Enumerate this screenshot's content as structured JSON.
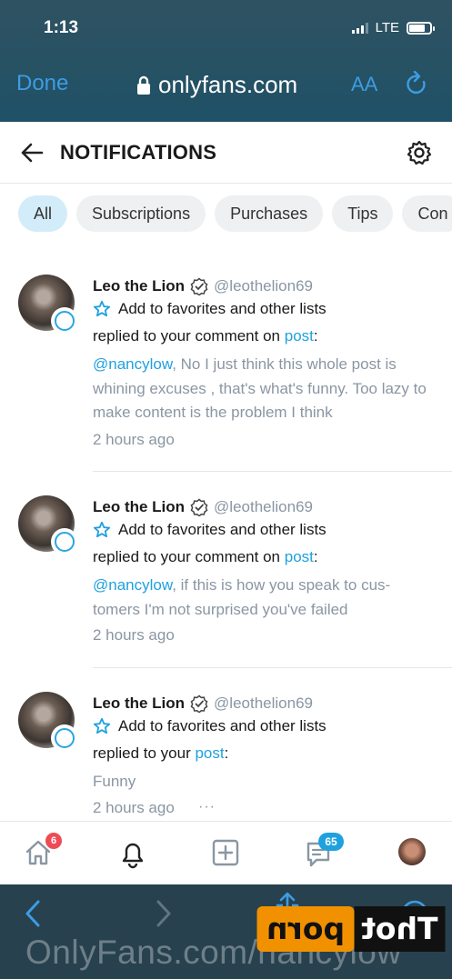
{
  "status_bar": {
    "time": "1:13",
    "network": "LTE"
  },
  "browser": {
    "done_label": "Done",
    "url": "onlyfans.com",
    "text_size_label": "AA"
  },
  "header": {
    "title": "NOTIFICATIONS"
  },
  "filters": {
    "tabs": [
      {
        "label": "All",
        "active": true
      },
      {
        "label": "Subscriptions"
      },
      {
        "label": "Purchases"
      },
      {
        "label": "Tips"
      },
      {
        "label": "Con"
      }
    ]
  },
  "notifications": [
    {
      "name": "Leo the Lion",
      "handle": "@leothelion69",
      "favorites_label": "Add to favorites and other lists",
      "action_prefix": "replied to your comment on",
      "action_link": "post",
      "action_suffix": ":",
      "mention": "@nancylow",
      "comment": ", No I just think this whole post is whining excuses , that's what's funny. Too lazy to make content is the problem I think",
      "time": "2 hours ago"
    },
    {
      "name": "Leo the Lion",
      "handle": "@leothelion69",
      "favorites_label": "Add to favorites and other lists",
      "action_prefix": "replied to your comment on",
      "action_link": "post",
      "action_suffix": ":",
      "mention": "@nancylow",
      "comment": ", if this is how you speak to cus- tomers I'm not surprised you've failed",
      "time": "2 hours ago"
    },
    {
      "name": "Leo the Lion",
      "handle": "@leothelion69",
      "favorites_label": "Add to favorites and other lists",
      "action_prefix": "replied to your",
      "action_link": "post",
      "action_suffix": ":",
      "comment": "Funny",
      "time": "2 hours ago",
      "more": "···"
    }
  ],
  "bottom_nav": {
    "home_badge": "6",
    "messages_badge": "65"
  },
  "overlay": {
    "watermark": "OnlyFans.com/nancylow",
    "logo_part1": "Thot",
    "logo_part2": "porn"
  },
  "colors": {
    "accent": "#1fa1de",
    "safari_bar": "#1f5166",
    "badge_red": "#ef4b56",
    "logo_orange": "#f29100"
  }
}
